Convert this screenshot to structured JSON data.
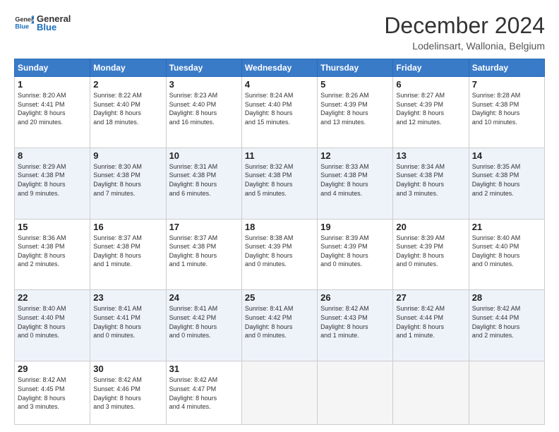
{
  "logo": {
    "line1": "General",
    "line2": "Blue"
  },
  "title": "December 2024",
  "location": "Lodelinsart, Wallonia, Belgium",
  "days_header": [
    "Sunday",
    "Monday",
    "Tuesday",
    "Wednesday",
    "Thursday",
    "Friday",
    "Saturday"
  ],
  "weeks": [
    [
      {
        "num": "1",
        "info": "Sunrise: 8:20 AM\nSunset: 4:41 PM\nDaylight: 8 hours\nand 20 minutes."
      },
      {
        "num": "2",
        "info": "Sunrise: 8:22 AM\nSunset: 4:40 PM\nDaylight: 8 hours\nand 18 minutes."
      },
      {
        "num": "3",
        "info": "Sunrise: 8:23 AM\nSunset: 4:40 PM\nDaylight: 8 hours\nand 16 minutes."
      },
      {
        "num": "4",
        "info": "Sunrise: 8:24 AM\nSunset: 4:40 PM\nDaylight: 8 hours\nand 15 minutes."
      },
      {
        "num": "5",
        "info": "Sunrise: 8:26 AM\nSunset: 4:39 PM\nDaylight: 8 hours\nand 13 minutes."
      },
      {
        "num": "6",
        "info": "Sunrise: 8:27 AM\nSunset: 4:39 PM\nDaylight: 8 hours\nand 12 minutes."
      },
      {
        "num": "7",
        "info": "Sunrise: 8:28 AM\nSunset: 4:38 PM\nDaylight: 8 hours\nand 10 minutes."
      }
    ],
    [
      {
        "num": "8",
        "info": "Sunrise: 8:29 AM\nSunset: 4:38 PM\nDaylight: 8 hours\nand 9 minutes."
      },
      {
        "num": "9",
        "info": "Sunrise: 8:30 AM\nSunset: 4:38 PM\nDaylight: 8 hours\nand 7 minutes."
      },
      {
        "num": "10",
        "info": "Sunrise: 8:31 AM\nSunset: 4:38 PM\nDaylight: 8 hours\nand 6 minutes."
      },
      {
        "num": "11",
        "info": "Sunrise: 8:32 AM\nSunset: 4:38 PM\nDaylight: 8 hours\nand 5 minutes."
      },
      {
        "num": "12",
        "info": "Sunrise: 8:33 AM\nSunset: 4:38 PM\nDaylight: 8 hours\nand 4 minutes."
      },
      {
        "num": "13",
        "info": "Sunrise: 8:34 AM\nSunset: 4:38 PM\nDaylight: 8 hours\nand 3 minutes."
      },
      {
        "num": "14",
        "info": "Sunrise: 8:35 AM\nSunset: 4:38 PM\nDaylight: 8 hours\nand 2 minutes."
      }
    ],
    [
      {
        "num": "15",
        "info": "Sunrise: 8:36 AM\nSunset: 4:38 PM\nDaylight: 8 hours\nand 2 minutes."
      },
      {
        "num": "16",
        "info": "Sunrise: 8:37 AM\nSunset: 4:38 PM\nDaylight: 8 hours\nand 1 minute."
      },
      {
        "num": "17",
        "info": "Sunrise: 8:37 AM\nSunset: 4:38 PM\nDaylight: 8 hours\nand 1 minute."
      },
      {
        "num": "18",
        "info": "Sunrise: 8:38 AM\nSunset: 4:39 PM\nDaylight: 8 hours\nand 0 minutes."
      },
      {
        "num": "19",
        "info": "Sunrise: 8:39 AM\nSunset: 4:39 PM\nDaylight: 8 hours\nand 0 minutes."
      },
      {
        "num": "20",
        "info": "Sunrise: 8:39 AM\nSunset: 4:39 PM\nDaylight: 8 hours\nand 0 minutes."
      },
      {
        "num": "21",
        "info": "Sunrise: 8:40 AM\nSunset: 4:40 PM\nDaylight: 8 hours\nand 0 minutes."
      }
    ],
    [
      {
        "num": "22",
        "info": "Sunrise: 8:40 AM\nSunset: 4:40 PM\nDaylight: 8 hours\nand 0 minutes."
      },
      {
        "num": "23",
        "info": "Sunrise: 8:41 AM\nSunset: 4:41 PM\nDaylight: 8 hours\nand 0 minutes."
      },
      {
        "num": "24",
        "info": "Sunrise: 8:41 AM\nSunset: 4:42 PM\nDaylight: 8 hours\nand 0 minutes."
      },
      {
        "num": "25",
        "info": "Sunrise: 8:41 AM\nSunset: 4:42 PM\nDaylight: 8 hours\nand 0 minutes."
      },
      {
        "num": "26",
        "info": "Sunrise: 8:42 AM\nSunset: 4:43 PM\nDaylight: 8 hours\nand 1 minute."
      },
      {
        "num": "27",
        "info": "Sunrise: 8:42 AM\nSunset: 4:44 PM\nDaylight: 8 hours\nand 1 minute."
      },
      {
        "num": "28",
        "info": "Sunrise: 8:42 AM\nSunset: 4:44 PM\nDaylight: 8 hours\nand 2 minutes."
      }
    ],
    [
      {
        "num": "29",
        "info": "Sunrise: 8:42 AM\nSunset: 4:45 PM\nDaylight: 8 hours\nand 3 minutes."
      },
      {
        "num": "30",
        "info": "Sunrise: 8:42 AM\nSunset: 4:46 PM\nDaylight: 8 hours\nand 3 minutes."
      },
      {
        "num": "31",
        "info": "Sunrise: 8:42 AM\nSunset: 4:47 PM\nDaylight: 8 hours\nand 4 minutes."
      },
      null,
      null,
      null,
      null
    ]
  ]
}
